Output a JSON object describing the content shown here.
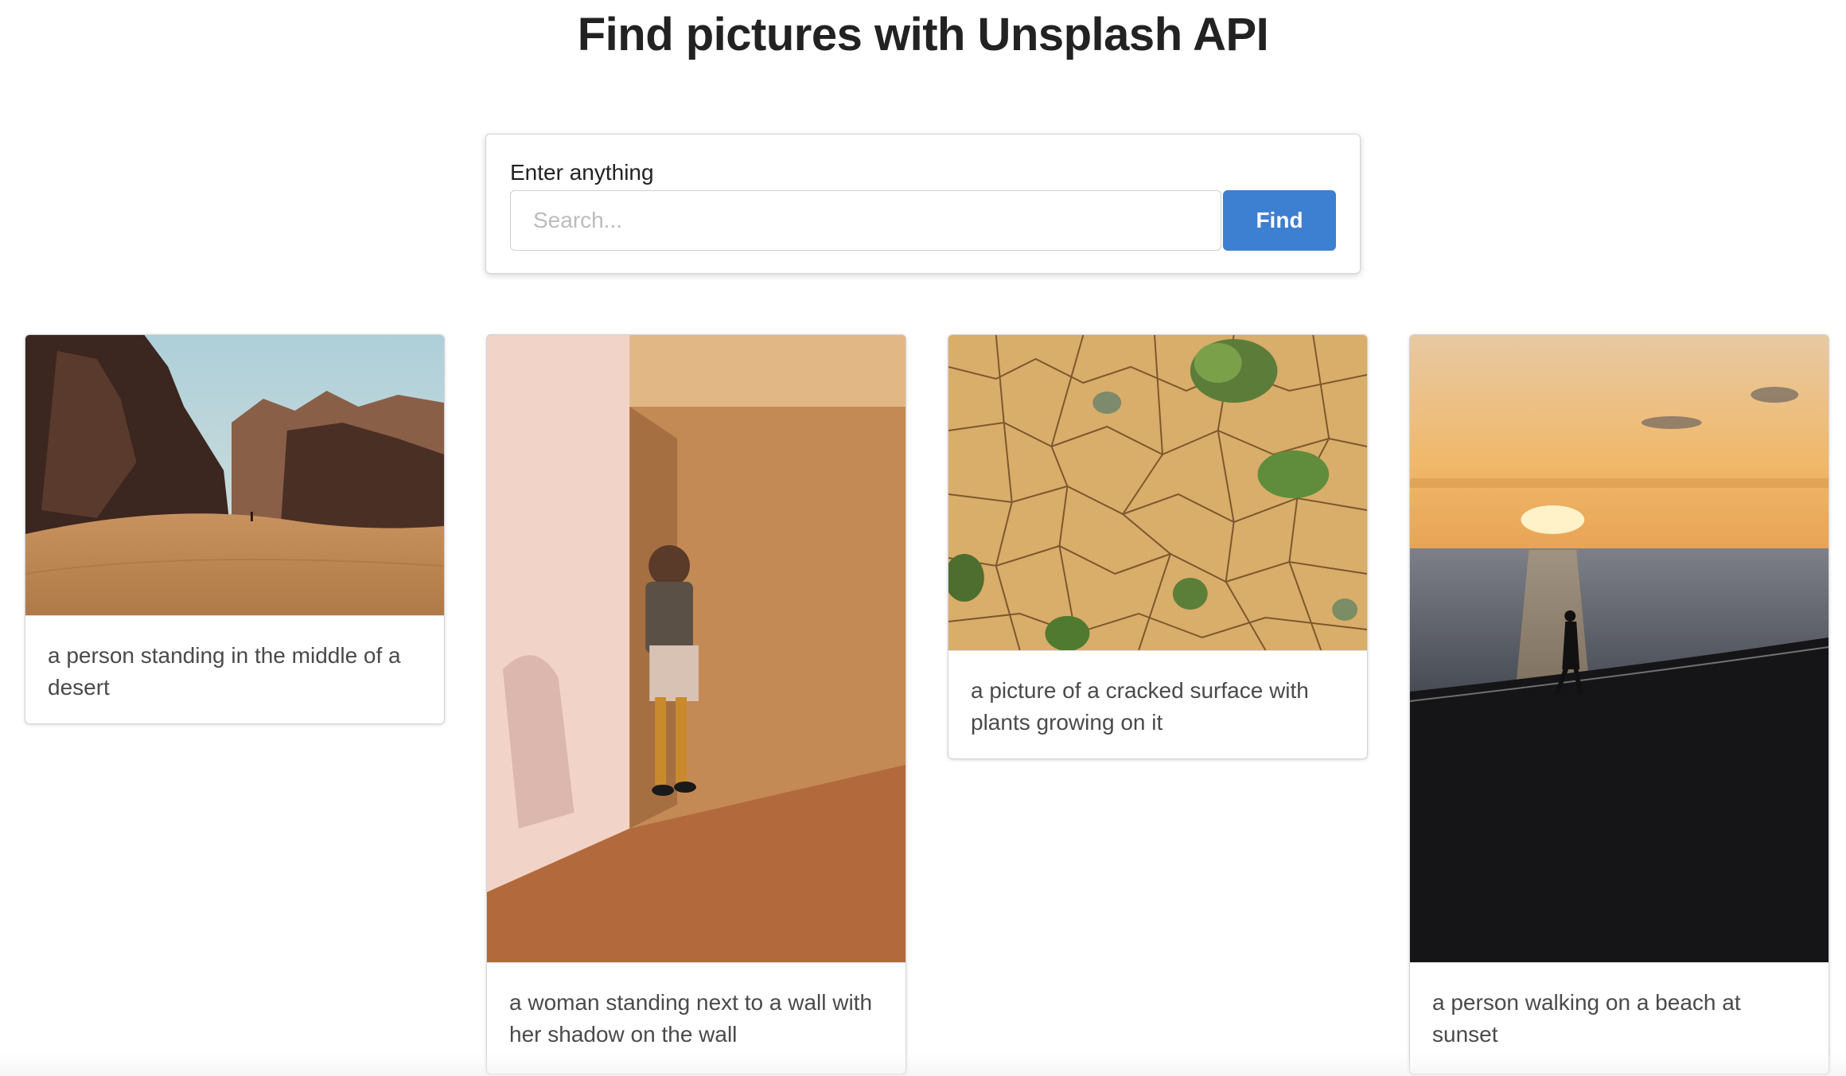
{
  "header": {
    "title": "Find pictures with Unsplash API"
  },
  "search": {
    "label": "Enter anything",
    "value": "",
    "placeholder": "Search...",
    "button_label": "Find",
    "button_color": "#3d7fd0"
  },
  "results": [
    {
      "caption": "a person standing in the middle of a desert"
    },
    {
      "caption": "a woman standing next to a wall with her shadow on the wall"
    },
    {
      "caption": "a picture of a cracked surface with plants growing on it"
    },
    {
      "caption": "a person walking on a beach at sunset"
    }
  ]
}
